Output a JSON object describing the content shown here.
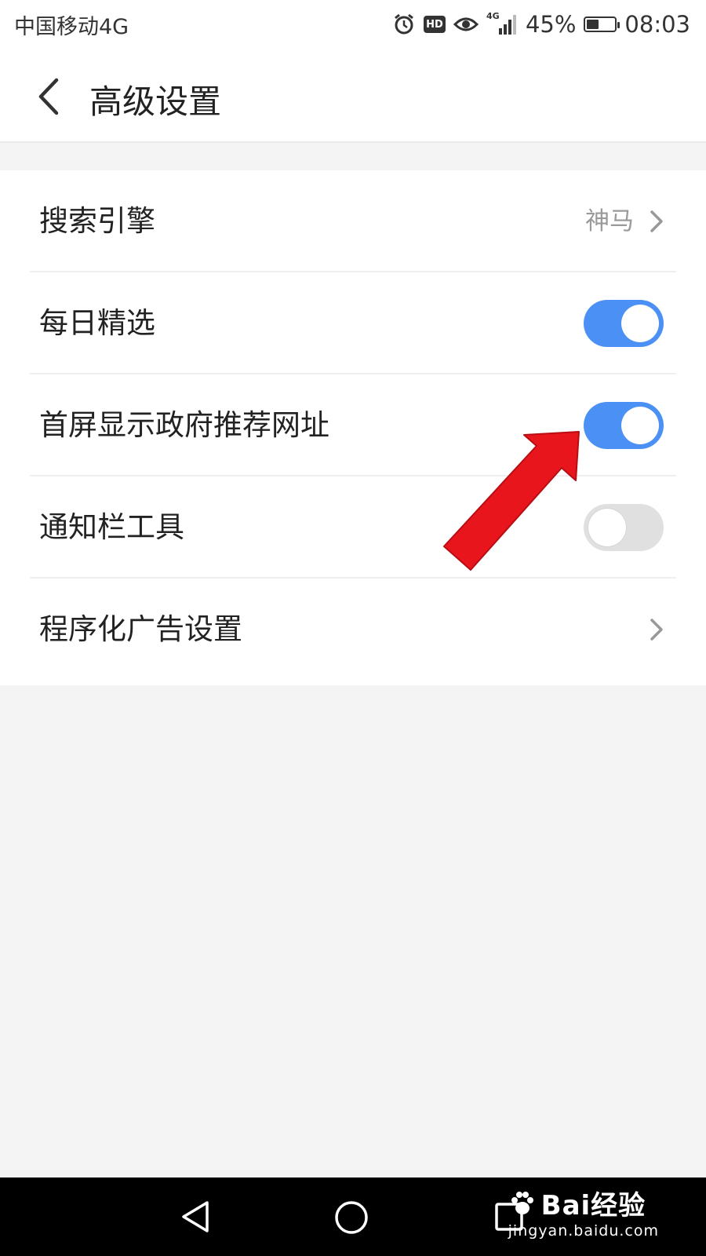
{
  "status_bar": {
    "carrier": "中国移动4G",
    "icons": [
      "alarm-icon",
      "hd-icon",
      "eye-icon",
      "signal-icon"
    ],
    "hd_label": "HD",
    "network_label": "4G",
    "battery_percent": "45%",
    "battery_level": 0.45,
    "time": "08:03"
  },
  "header": {
    "back_icon": "chevron-left-icon",
    "title": "高级设置"
  },
  "settings": {
    "items": [
      {
        "label": "搜索引擎",
        "type": "link",
        "value": "神马"
      },
      {
        "label": "每日精选",
        "type": "toggle",
        "on": true
      },
      {
        "label": "首屏显示政府推荐网址",
        "type": "toggle",
        "on": true
      },
      {
        "label": "通知栏工具",
        "type": "toggle",
        "on": false
      },
      {
        "label": "程序化广告设置",
        "type": "link",
        "value": ""
      }
    ]
  },
  "colors": {
    "toggle_on": "#4a90f5",
    "toggle_off": "#e0e0e0",
    "annotation_arrow": "#e8161c"
  },
  "nav_bar": {
    "icons": [
      "nav-back-icon",
      "nav-home-icon",
      "nav-recent-icon"
    ]
  },
  "watermark": {
    "brand": "Bai经验",
    "url": "jingyan.baidu.com"
  }
}
